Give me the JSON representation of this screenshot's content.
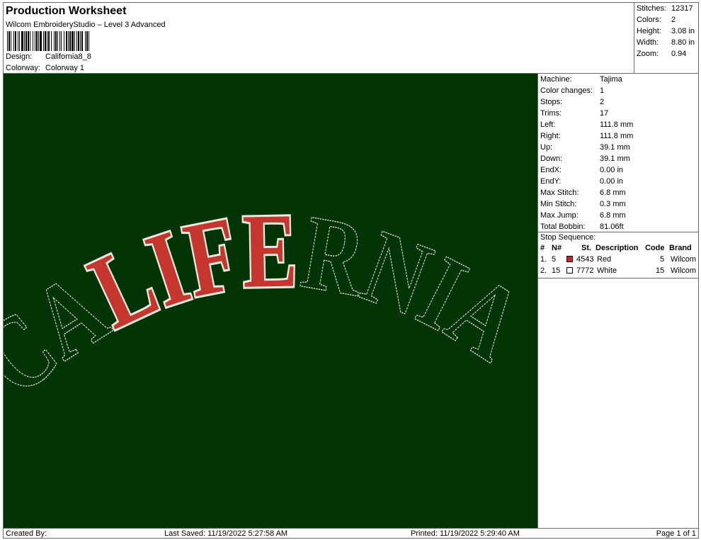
{
  "header": {
    "title": "Production Worksheet",
    "subtitle": "Wilcom EmbroideryStudio – Level 3 Advanced",
    "design_label": "Design:",
    "design_value": "California8_8",
    "colorway_label": "Colorway:",
    "colorway_value": "Colorway 1"
  },
  "summary": {
    "stitches_label": "Stitches:",
    "stitches_value": "12317",
    "colors_label": "Colors:",
    "colors_value": "2",
    "height_label": "Height:",
    "height_value": "3.08 in",
    "width_label": "Width:",
    "width_value": "8.80 in",
    "zoom_label": "Zoom:",
    "zoom_value": "0.94"
  },
  "design": {
    "text": "CALIFERNIA",
    "background_color": "#033406",
    "fill_color": "#c5362f",
    "outline_color": "#e8ecdf"
  },
  "info": {
    "machine_label": "Machine:",
    "machine_value": "Tajima",
    "color_changes_label": "Color changes:",
    "color_changes_value": "1",
    "stops_label": "Stops:",
    "stops_value": "2",
    "trims_label": "Trims:",
    "trims_value": "17",
    "left_label": "Left:",
    "left_value": "111.8 mm",
    "right_label": "Right:",
    "right_value": "111.8 mm",
    "up_label": "Up:",
    "up_value": "39.1 mm",
    "down_label": "Down:",
    "down_value": "39.1 mm",
    "endx_label": "EndX:",
    "endx_value": "0.00 in",
    "endy_label": "EndY:",
    "endy_value": "0.00 in",
    "max_stitch_label": "Max Stitch:",
    "max_stitch_value": "6.8 mm",
    "min_stitch_label": "Min Stitch:",
    "min_stitch_value": "0.3 mm",
    "max_jump_label": "Max Jump:",
    "max_jump_value": "6.8 mm",
    "total_bobbin_label": "Total Bobbin:",
    "total_bobbin_value": "81.06ft"
  },
  "stop_sequence": {
    "label": "Stop Sequence:",
    "columns": [
      "#",
      "N#",
      "St.",
      "Description",
      "Code",
      "Brand"
    ],
    "rows": [
      {
        "num": "1.",
        "n": "5",
        "color": "#d42027",
        "st": "4543",
        "description": "Red",
        "code": "5",
        "brand": "Wilcom"
      },
      {
        "num": "2.",
        "n": "15",
        "color": "#ffffff",
        "st": "7772",
        "description": "White",
        "code": "15",
        "brand": "Wilcom"
      }
    ]
  },
  "footer": {
    "created_by": "Created By:",
    "last_saved": "Last Saved: 11/19/2022 5:27:58 AM",
    "printed": "Printed: 11/19/2022 5:29:40 AM",
    "page": "Page 1 of 1"
  }
}
